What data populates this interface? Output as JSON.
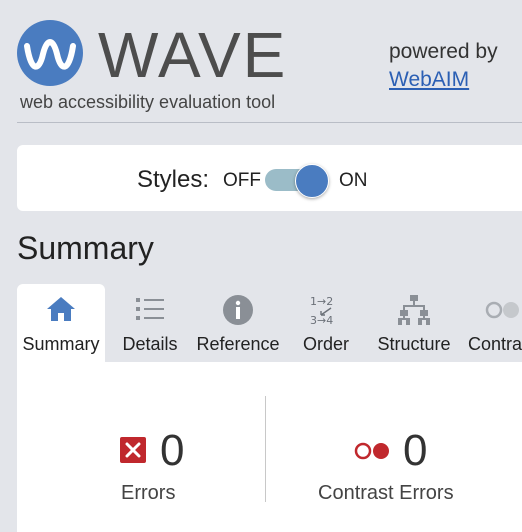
{
  "header": {
    "brand": "WAVE",
    "tagline": "web accessibility evaluation tool",
    "powered_by": "powered by",
    "webaim_link": "WebAIM"
  },
  "styles_toggle": {
    "label": "Styles:",
    "off_label": "OFF",
    "on_label": "ON",
    "state": "on"
  },
  "summary": {
    "heading": "Summary"
  },
  "tabs": [
    {
      "label": "Summary",
      "icon": "home-icon",
      "active": true
    },
    {
      "label": "Details",
      "icon": "list-icon",
      "active": false
    },
    {
      "label": "Reference",
      "icon": "info-icon",
      "active": false
    },
    {
      "label": "Order",
      "icon": "order-icon",
      "active": false
    },
    {
      "label": "Structure",
      "icon": "structure-icon",
      "active": false
    },
    {
      "label": "Contra",
      "icon": "contrast-icon",
      "active": false
    }
  ],
  "stats": {
    "errors": {
      "count": "0",
      "label": "Errors"
    },
    "contrast_errors": {
      "count": "0",
      "label": "Contrast Errors"
    }
  },
  "colors": {
    "accent": "#4a7cc0",
    "error": "#c0282d",
    "link": "#2b5fb4"
  }
}
